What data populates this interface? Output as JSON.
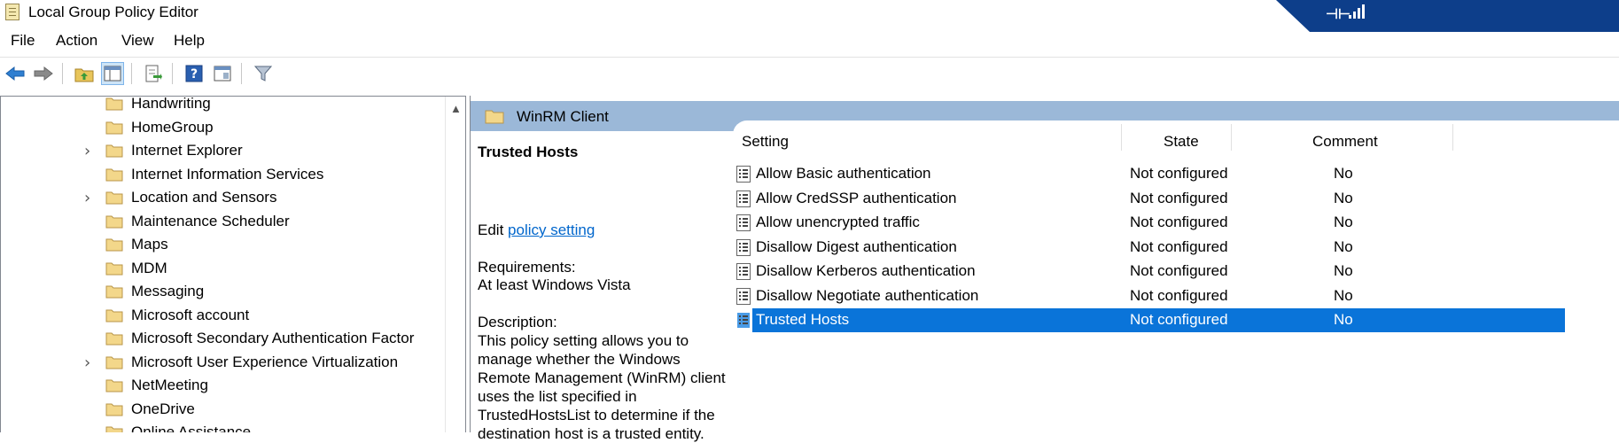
{
  "window": {
    "title": "Local Group Policy Editor"
  },
  "menu": [
    "File",
    "Action",
    "View",
    "Help"
  ],
  "toolbar": [
    "back-icon",
    "forward-icon",
    "up-folder-icon",
    "show-hide-tree-icon",
    "export-list-icon",
    "help-icon",
    "properties-icon",
    "filter-icon"
  ],
  "tree": {
    "items": [
      {
        "label": "Handwriting",
        "expandable": false
      },
      {
        "label": "HomeGroup",
        "expandable": false
      },
      {
        "label": "Internet Explorer",
        "expandable": true
      },
      {
        "label": "Internet Information Services",
        "expandable": false
      },
      {
        "label": "Location and Sensors",
        "expandable": true
      },
      {
        "label": "Maintenance Scheduler",
        "expandable": false
      },
      {
        "label": "Maps",
        "expandable": false
      },
      {
        "label": "MDM",
        "expandable": false
      },
      {
        "label": "Messaging",
        "expandable": false
      },
      {
        "label": "Microsoft account",
        "expandable": false
      },
      {
        "label": "Microsoft Secondary Authentication Factor",
        "expandable": false
      },
      {
        "label": "Microsoft User Experience Virtualization",
        "expandable": true
      },
      {
        "label": "NetMeeting",
        "expandable": false
      },
      {
        "label": "OneDrive",
        "expandable": false
      },
      {
        "label": "Online Assistance",
        "expandable": false
      }
    ]
  },
  "header": {
    "title": "WinRM Client"
  },
  "description": {
    "title": "Trusted Hosts",
    "edit_prefix": "Edit ",
    "edit_link": "policy setting ",
    "requirements_label": "Requirements:",
    "requirements_value": "At least Windows Vista",
    "description_label": "Description:",
    "description_text": "This policy setting allows you to manage whether the Windows Remote Management (WinRM) client uses the list specified in TrustedHostsList to determine if the destination host is a trusted entity."
  },
  "list": {
    "columns": [
      "Setting",
      "State",
      "Comment"
    ],
    "rows": [
      {
        "setting": "Allow Basic authentication",
        "state": "Not configured",
        "comment": "No"
      },
      {
        "setting": "Allow CredSSP authentication",
        "state": "Not configured",
        "comment": "No"
      },
      {
        "setting": "Allow unencrypted traffic",
        "state": "Not configured",
        "comment": "No"
      },
      {
        "setting": "Disallow Digest authentication",
        "state": "Not configured",
        "comment": "No"
      },
      {
        "setting": "Disallow Kerberos authentication",
        "state": "Not configured",
        "comment": "No"
      },
      {
        "setting": "Disallow Negotiate authentication",
        "state": "Not configured",
        "comment": "No"
      },
      {
        "setting": "Trusted Hosts",
        "state": "Not configured",
        "comment": "No",
        "selected": true
      }
    ]
  },
  "colors": {
    "selection": "#0a74d9",
    "header_band": "#9bb8d8",
    "link": "#0066cc",
    "rd_bar": "#0d3e8a"
  }
}
